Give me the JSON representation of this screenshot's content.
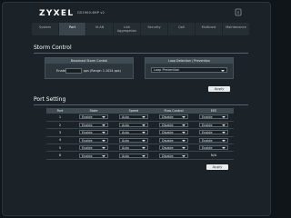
{
  "header": {
    "logo": "ZYXEL",
    "model": "GS1900-8HP v2",
    "icon": "info-icon"
  },
  "nav": {
    "tabs": [
      {
        "label": "System",
        "active": false
      },
      {
        "label": "Port",
        "active": true
      },
      {
        "label": "VLAN",
        "active": false
      },
      {
        "label": "Link Aggregation",
        "active": false
      },
      {
        "label": "Security",
        "active": false
      },
      {
        "label": "QoS",
        "active": false
      },
      {
        "label": "Multicast",
        "active": false
      },
      {
        "label": "Maintenance",
        "active": false
      }
    ]
  },
  "storm_control": {
    "title": "Storm Control",
    "broadcast_box_header": "Broadcast Storm Control",
    "enable_label": "Enable",
    "rate_value": "",
    "rate_unit": "pps (Range: 1-1024 pps)",
    "loop_box_header": "Loop Detection / Prevention",
    "loop_select_value": "Loop Prevention",
    "apply_label": "Apply"
  },
  "port_setting": {
    "title": "Port Setting",
    "columns": [
      "Port",
      "State",
      "Speed",
      "Flow Control",
      "EEE"
    ],
    "rows": [
      {
        "port": "1",
        "state": "Enable",
        "speed": "Auto",
        "flow": "Disable",
        "eee": "Enable"
      },
      {
        "port": "2",
        "state": "Enable",
        "speed": "Auto",
        "flow": "Disable",
        "eee": "Enable"
      },
      {
        "port": "3",
        "state": "Enable",
        "speed": "Auto",
        "flow": "Disable",
        "eee": "Enable"
      },
      {
        "port": "4",
        "state": "Enable",
        "speed": "Auto",
        "flow": "Disable",
        "eee": "Enable"
      },
      {
        "port": "5",
        "state": "Enable",
        "speed": "Auto",
        "flow": "Disable",
        "eee": "Enable"
      },
      {
        "port": "6",
        "state": "Enable",
        "speed": "Auto",
        "flow": "Disable",
        "eee": "N/A"
      }
    ],
    "apply_label": "Apply"
  }
}
